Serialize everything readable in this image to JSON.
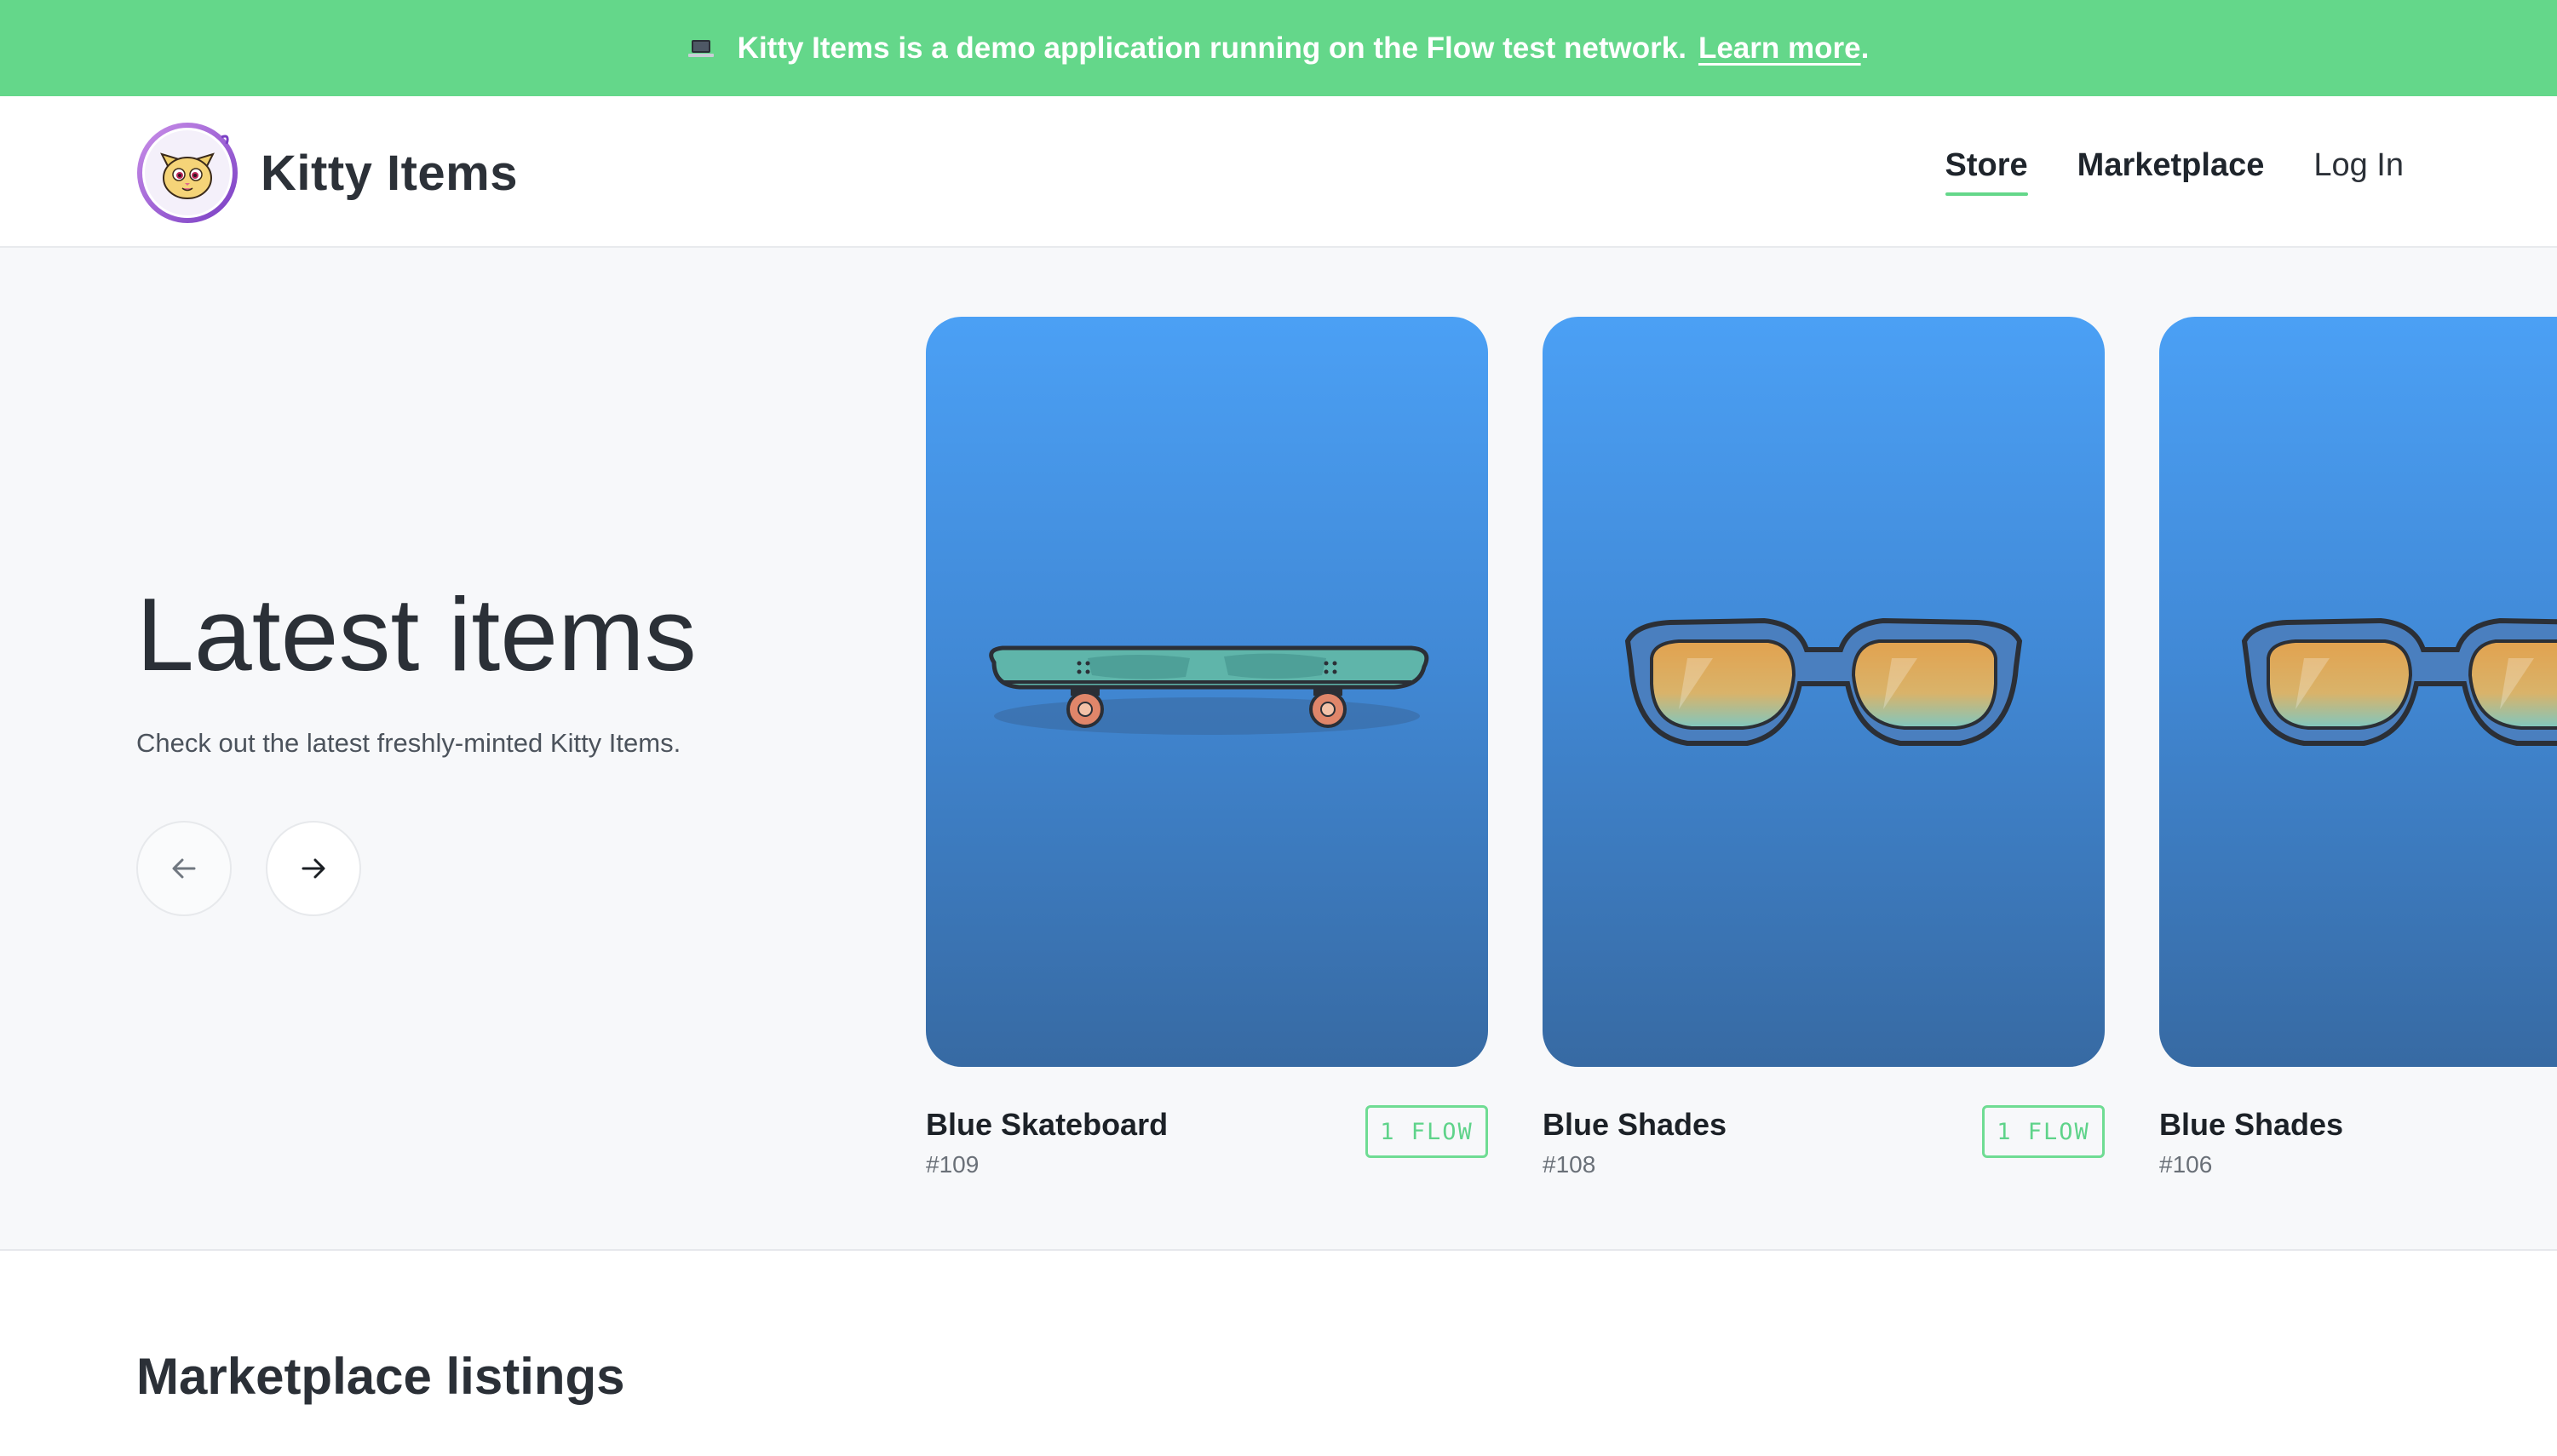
{
  "banner": {
    "icon": "laptop-icon",
    "text": "Kitty Items is a demo application running on the Flow test network.",
    "link_label": "Learn more",
    "trailing": ".",
    "bg_color": "#64d78a"
  },
  "header": {
    "brand": "Kitty Items",
    "nav": {
      "store": "Store",
      "marketplace": "Marketplace",
      "login": "Log In"
    },
    "active_nav": "Store"
  },
  "hero": {
    "title": "Latest items",
    "subtitle": "Check out the latest freshly-minted Kitty Items."
  },
  "items": [
    {
      "name": "Blue Skateboard",
      "id": "#109",
      "price": "1 FLOW",
      "kind": "skateboard"
    },
    {
      "name": "Blue Shades",
      "id": "#108",
      "price": "1 FLOW",
      "kind": "shades"
    },
    {
      "name": "Blue Shades",
      "id": "#106",
      "price": "",
      "kind": "shades"
    }
  ],
  "listings": {
    "title": "Marketplace listings"
  },
  "colors": {
    "accent": "#64d78a",
    "card_gradient_top": "#4ba0f5",
    "card_gradient_bottom": "#376aa3"
  }
}
